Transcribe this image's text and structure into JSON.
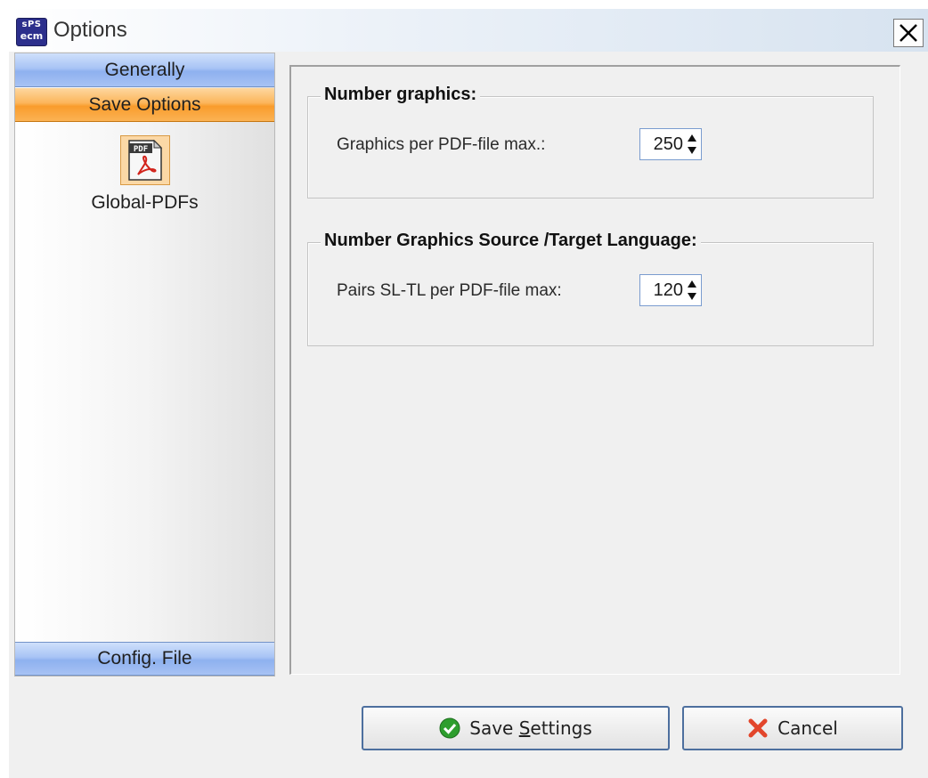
{
  "window": {
    "title": "Options",
    "app_icon_text_top": "sPS",
    "app_icon_text_bottom": "ecm",
    "close_icon": "close-icon"
  },
  "sidebar": {
    "categories": [
      {
        "label": "Generally",
        "color": "#a8c4f5"
      },
      {
        "label": "Save Options",
        "color": "#fcb55b",
        "selected": true
      },
      {
        "label": "Config. File",
        "color": "#a8c4f5"
      }
    ],
    "items": [
      {
        "label": "Global-PDFs",
        "icon": "pdf-file-icon",
        "icon_text": "PDF"
      }
    ]
  },
  "groups": [
    {
      "title": "Number graphics:",
      "field_label": "Graphics per PDF-file max.:",
      "value": "250"
    },
    {
      "title": "Number Graphics Source /Target Language:",
      "field_label": "Pairs SL-TL per PDF-file max:",
      "value": "120"
    }
  ],
  "buttons": {
    "save": {
      "pre": "Save ",
      "accel": "S",
      "post": "ettings",
      "icon": "check-circle-icon",
      "icon_color": "#2e9e2e"
    },
    "cancel": {
      "label": "Cancel",
      "icon": "red-x-icon",
      "icon_color": "#e2462b"
    }
  }
}
